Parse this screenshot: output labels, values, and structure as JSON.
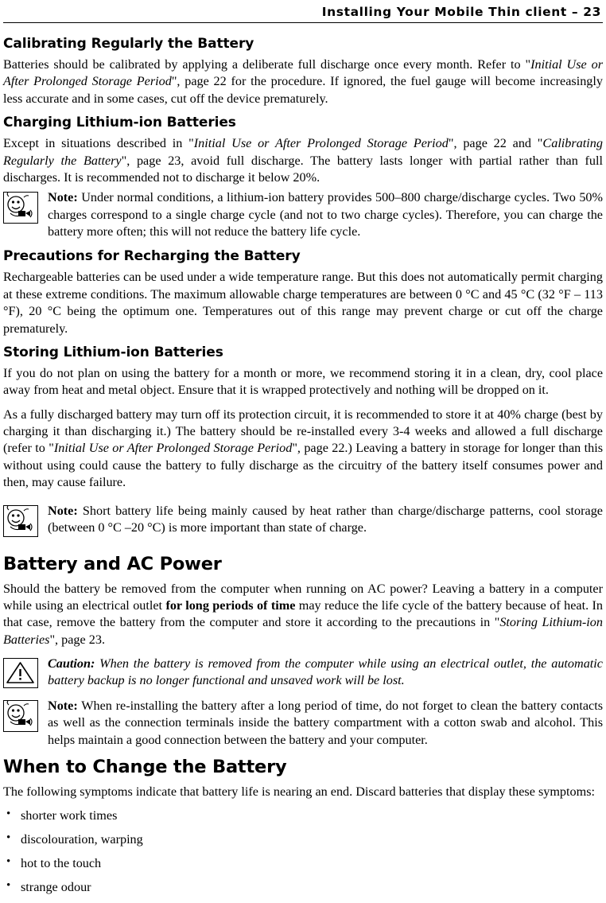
{
  "header": {
    "running_title": "Installing Your Mobile Thin client – 23"
  },
  "sections": {
    "calibrating": {
      "heading": "Calibrating Regularly the Battery",
      "p1_a": "Batteries should be calibrated by applying a deliberate full discharge once every month. Refer to \"",
      "p1_italic": "Initial Use or After Prolonged Storage Period",
      "p1_b": "\", page 22 for the procedure. If ignored, the fuel gauge will become increasingly less accurate and in some cases, cut off the device prematurely."
    },
    "charging": {
      "heading": "Charging Lithium-ion Batteries",
      "p1_a": "Except in situations described in \"",
      "p1_italic1": "Initial Use or After Prolonged Storage Period",
      "p1_b": "\", page 22 and \"",
      "p1_italic2": "Calibrating Regularly the Battery",
      "p1_c": "\", page 23, avoid full discharge. The battery lasts longer with partial rather than full discharges. It is recommended not to discharge it below 20%.",
      "note_label": "Note:",
      "note_text": " Under normal conditions, a lithium-ion battery provides 500–800 charge/discharge cycles. Two 50% charges correspond to a single charge cycle (and not to two charge cycles). Therefore, you can charge the battery more often; this will not reduce the battery life cycle."
    },
    "precautions": {
      "heading": "Precautions for Recharging the Battery",
      "p1": "Rechargeable batteries can be used under a wide temperature range. But this does not automatically permit charging at these extreme conditions. The maximum allowable charge temperatures are between 0 °C and 45 °C (32 °F – 113 °F), 20 °C being the optimum one. Temperatures out of this range may prevent charge or cut off the charge prematurely."
    },
    "storing": {
      "heading": "Storing Lithium-ion Batteries",
      "p1": "If you do not plan on using the battery for a month or more, we recommend storing it in a clean, dry, cool place away from heat and metal object. Ensure that it is wrapped protectively and nothing will be dropped on it.",
      "p2_a": "As a fully discharged battery may turn off its protection circuit, it is recommended to store it at 40% charge (best by charging it than discharging it.) The battery should be re-installed every 3-4 weeks and allowed a full discharge (refer to \"",
      "p2_italic": "Initial Use or After Prolonged Storage Period",
      "p2_b": "\", page 22.) Leaving a battery in storage for longer than this without using could cause the battery to fully discharge as the circuitry of the battery itself consumes power and then, may cause failure.",
      "note_label": "Note:",
      "note_text": " Short battery life being mainly caused by heat rather than charge/discharge patterns, cool storage (between 0 °C –20 °C) is more important than state of charge."
    },
    "battery_ac": {
      "heading": "Battery and AC Power",
      "p1_a": "Should the battery be removed from the computer when running on AC power? Leaving a battery in a computer while using an electrical outlet ",
      "p1_bold": "for long periods of time",
      "p1_b": " may reduce the life cycle of the battery because of heat. In that case, remove the battery from the computer and store it according to the precautions in \"",
      "p1_italic": "Storing Lithium-ion Batteries",
      "p1_c": "\", page 23.",
      "caution_label": "Caution:",
      "caution_text": " When the battery is removed from the computer while using an electrical outlet, the automatic battery backup is no longer functional and unsaved work will be lost.",
      "note_label": "Note:",
      "note_text": " When re-installing the battery after a long period of time, do not forget to clean the battery contacts as well as the connection terminals inside the battery compartment with a cotton swab and alcohol. This helps maintain a good connection between the battery and your computer."
    },
    "when_to_change": {
      "heading": "When to Change the Battery",
      "p1": "The following symptoms indicate that battery life is nearing an end. Discard batteries that display these symptoms:",
      "bullets": [
        "shorter work times",
        "discolouration, warping",
        "hot to the touch",
        "strange odour"
      ]
    }
  }
}
